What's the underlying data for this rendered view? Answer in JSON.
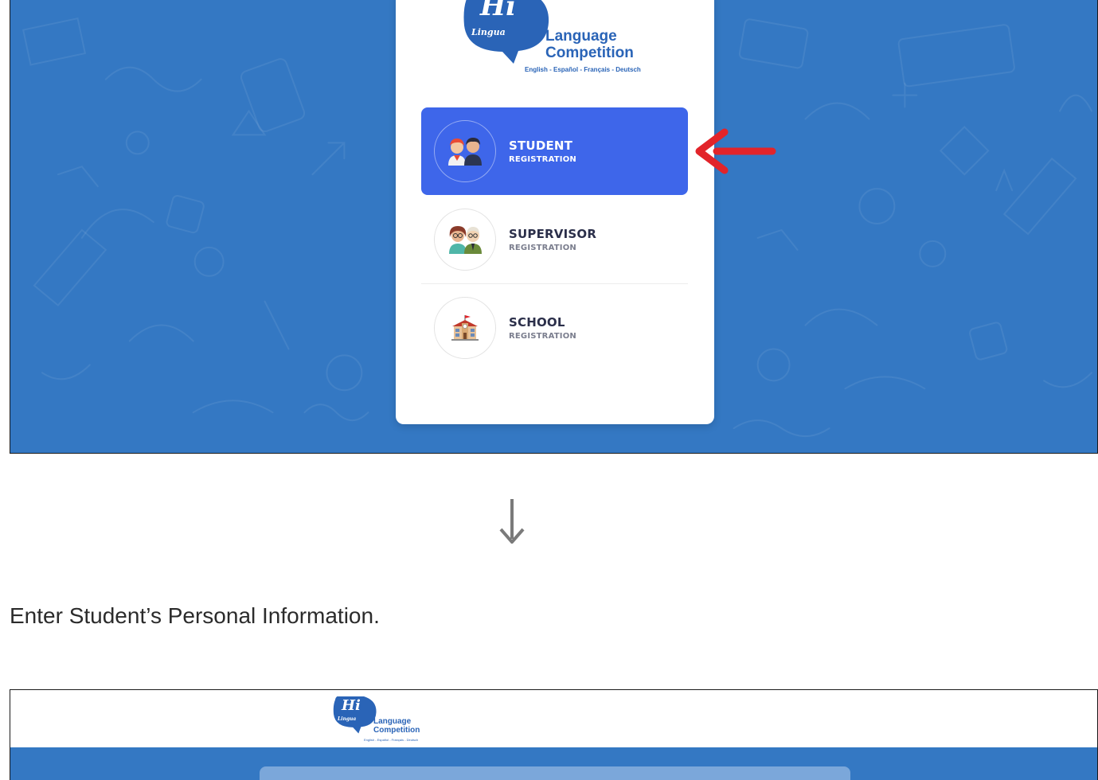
{
  "logo": {
    "hi": "Hi",
    "lingua": "Lingua",
    "line1": "Language",
    "line2": "Competition",
    "languages": "English - Español - Français - Deutsch"
  },
  "registration_options": [
    {
      "title": "STUDENT",
      "subtitle": "REGISTRATION",
      "icon": "students-avatar-icon",
      "selected": true
    },
    {
      "title": "SUPERVISOR",
      "subtitle": "REGISTRATION",
      "icon": "supervisors-avatar-icon",
      "selected": false
    },
    {
      "title": "SCHOOL",
      "subtitle": "REGISTRATION",
      "icon": "school-building-icon",
      "selected": false
    }
  ],
  "instruction": "Enter Student’s Personal Information.",
  "colors": {
    "background_blue": "#3478c3",
    "active_item": "#3e66ea",
    "brand_blue": "#2a64b7",
    "pointer_red": "#e2242a"
  }
}
